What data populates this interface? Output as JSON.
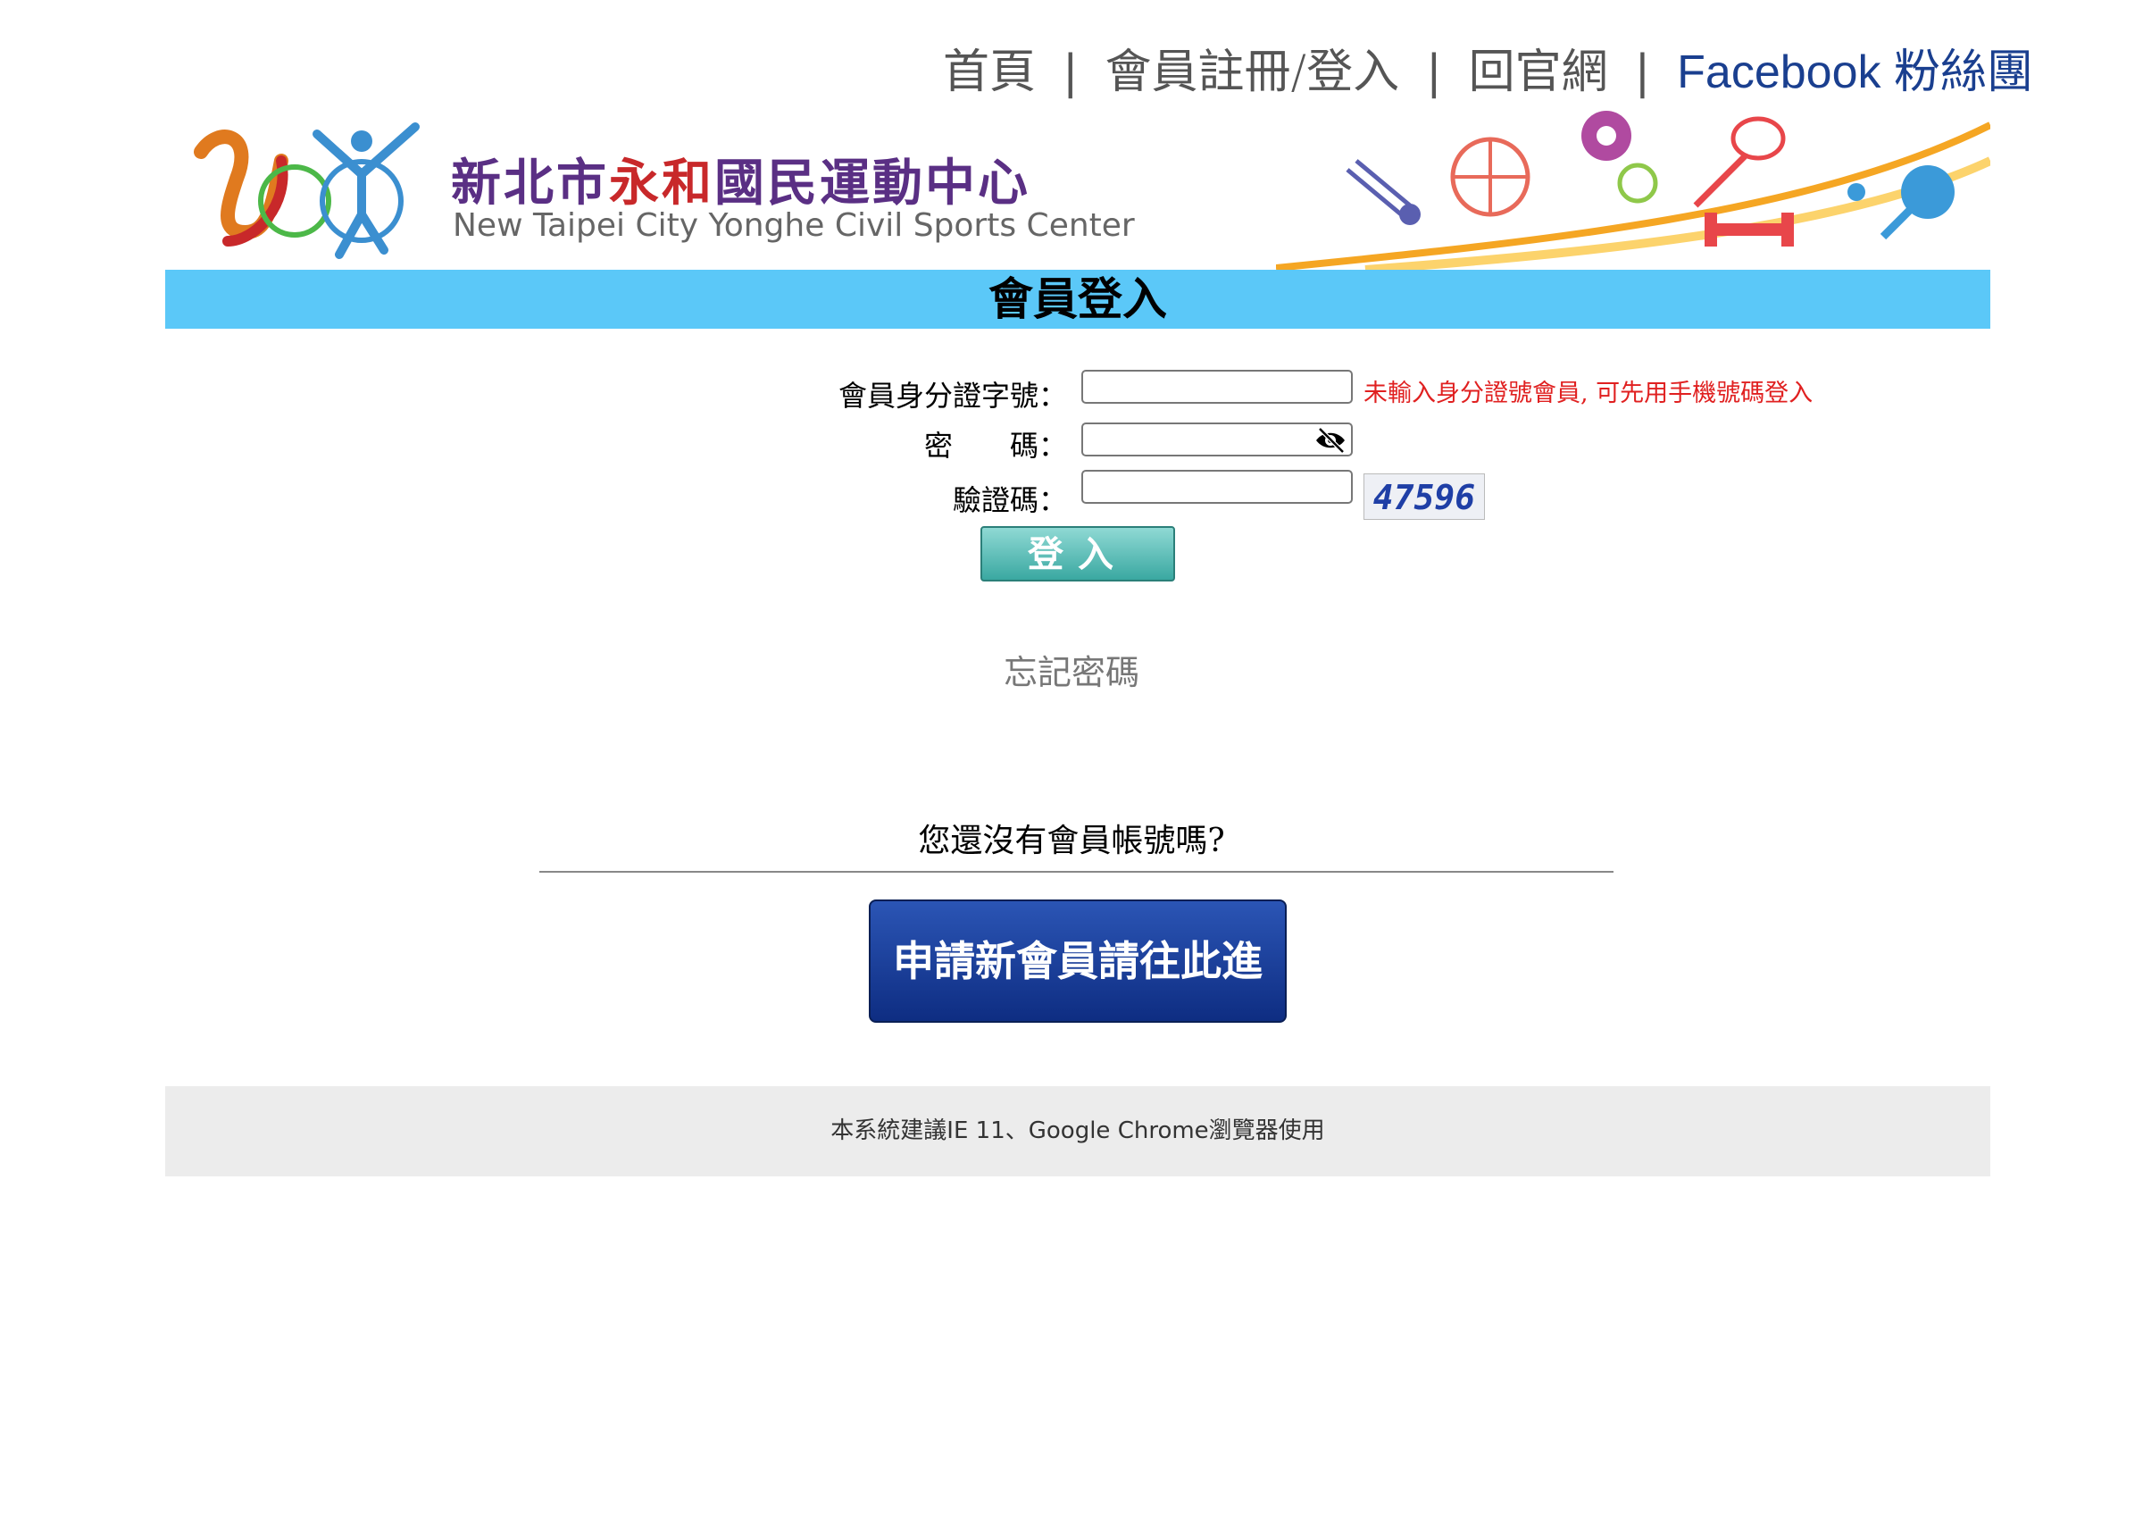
{
  "nav": {
    "home": "首頁",
    "member": "會員註冊/登入",
    "official": "回官網",
    "facebook": "Facebook 粉絲團",
    "sep": "|"
  },
  "banner": {
    "zh_prefix": "新北市",
    "zh_red": "永和",
    "zh_suffix": "國民運動中心",
    "en": "New Taipei City Yonghe Civil Sports Center"
  },
  "page_title": "會員登入",
  "form": {
    "id_label": "會員身分證字號：",
    "id_value": "",
    "id_hint": "未輸入身分證號會員, 可先用手機號碼登入",
    "password_label": "密　　碼：",
    "password_value": "",
    "captcha_label": "驗證碼：",
    "captcha_value": "",
    "captcha_code": "47596",
    "login_button": "登入"
  },
  "forgot_password": "忘記密碼",
  "no_account_question": "您還沒有會員帳號嗎?",
  "register_button": "申請新會員請往此進",
  "footer_text": "本系統建議IE 11、Google Chrome瀏覽器使用",
  "colors": {
    "title_bar": "#5bc8f8",
    "hint": "#e02020",
    "register_button": "#0e2d82",
    "login_button": "#3aa8a1"
  },
  "icons": {
    "eye_toggle": "eye-slash-icon"
  }
}
